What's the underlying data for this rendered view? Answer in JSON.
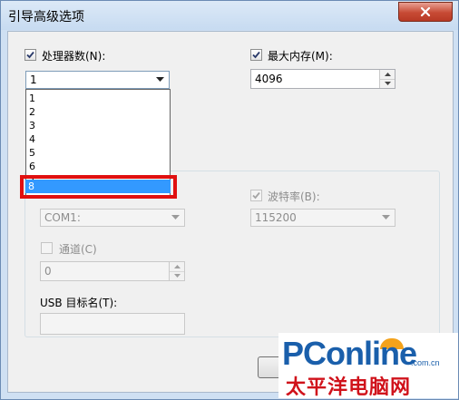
{
  "window": {
    "title": "引导高级选项",
    "close_icon": "close-icon"
  },
  "processors": {
    "label": "处理器数(N):",
    "checked": true,
    "value": "1",
    "options": [
      "1",
      "2",
      "3",
      "4",
      "5",
      "6",
      "7",
      "8"
    ],
    "selected": "8"
  },
  "memory": {
    "label": "最大内存(M):",
    "checked": true,
    "value": "4096"
  },
  "debug": {
    "port": "COM1:",
    "baud_label": "波特率(B):",
    "baud_checked": true,
    "baud_value": "115200",
    "channel_label": "通道(C)",
    "channel_checked": false,
    "channel_value": "0",
    "usb_label": "USB 目标名(T):",
    "usb_value": ""
  },
  "watermark": {
    "logo": "PConline",
    "domain": ".com.cn",
    "chinese": "太平洋电脑网"
  },
  "colors": {
    "highlight": "#e01010",
    "selection": "#3399ff",
    "close": "#c74a35"
  }
}
